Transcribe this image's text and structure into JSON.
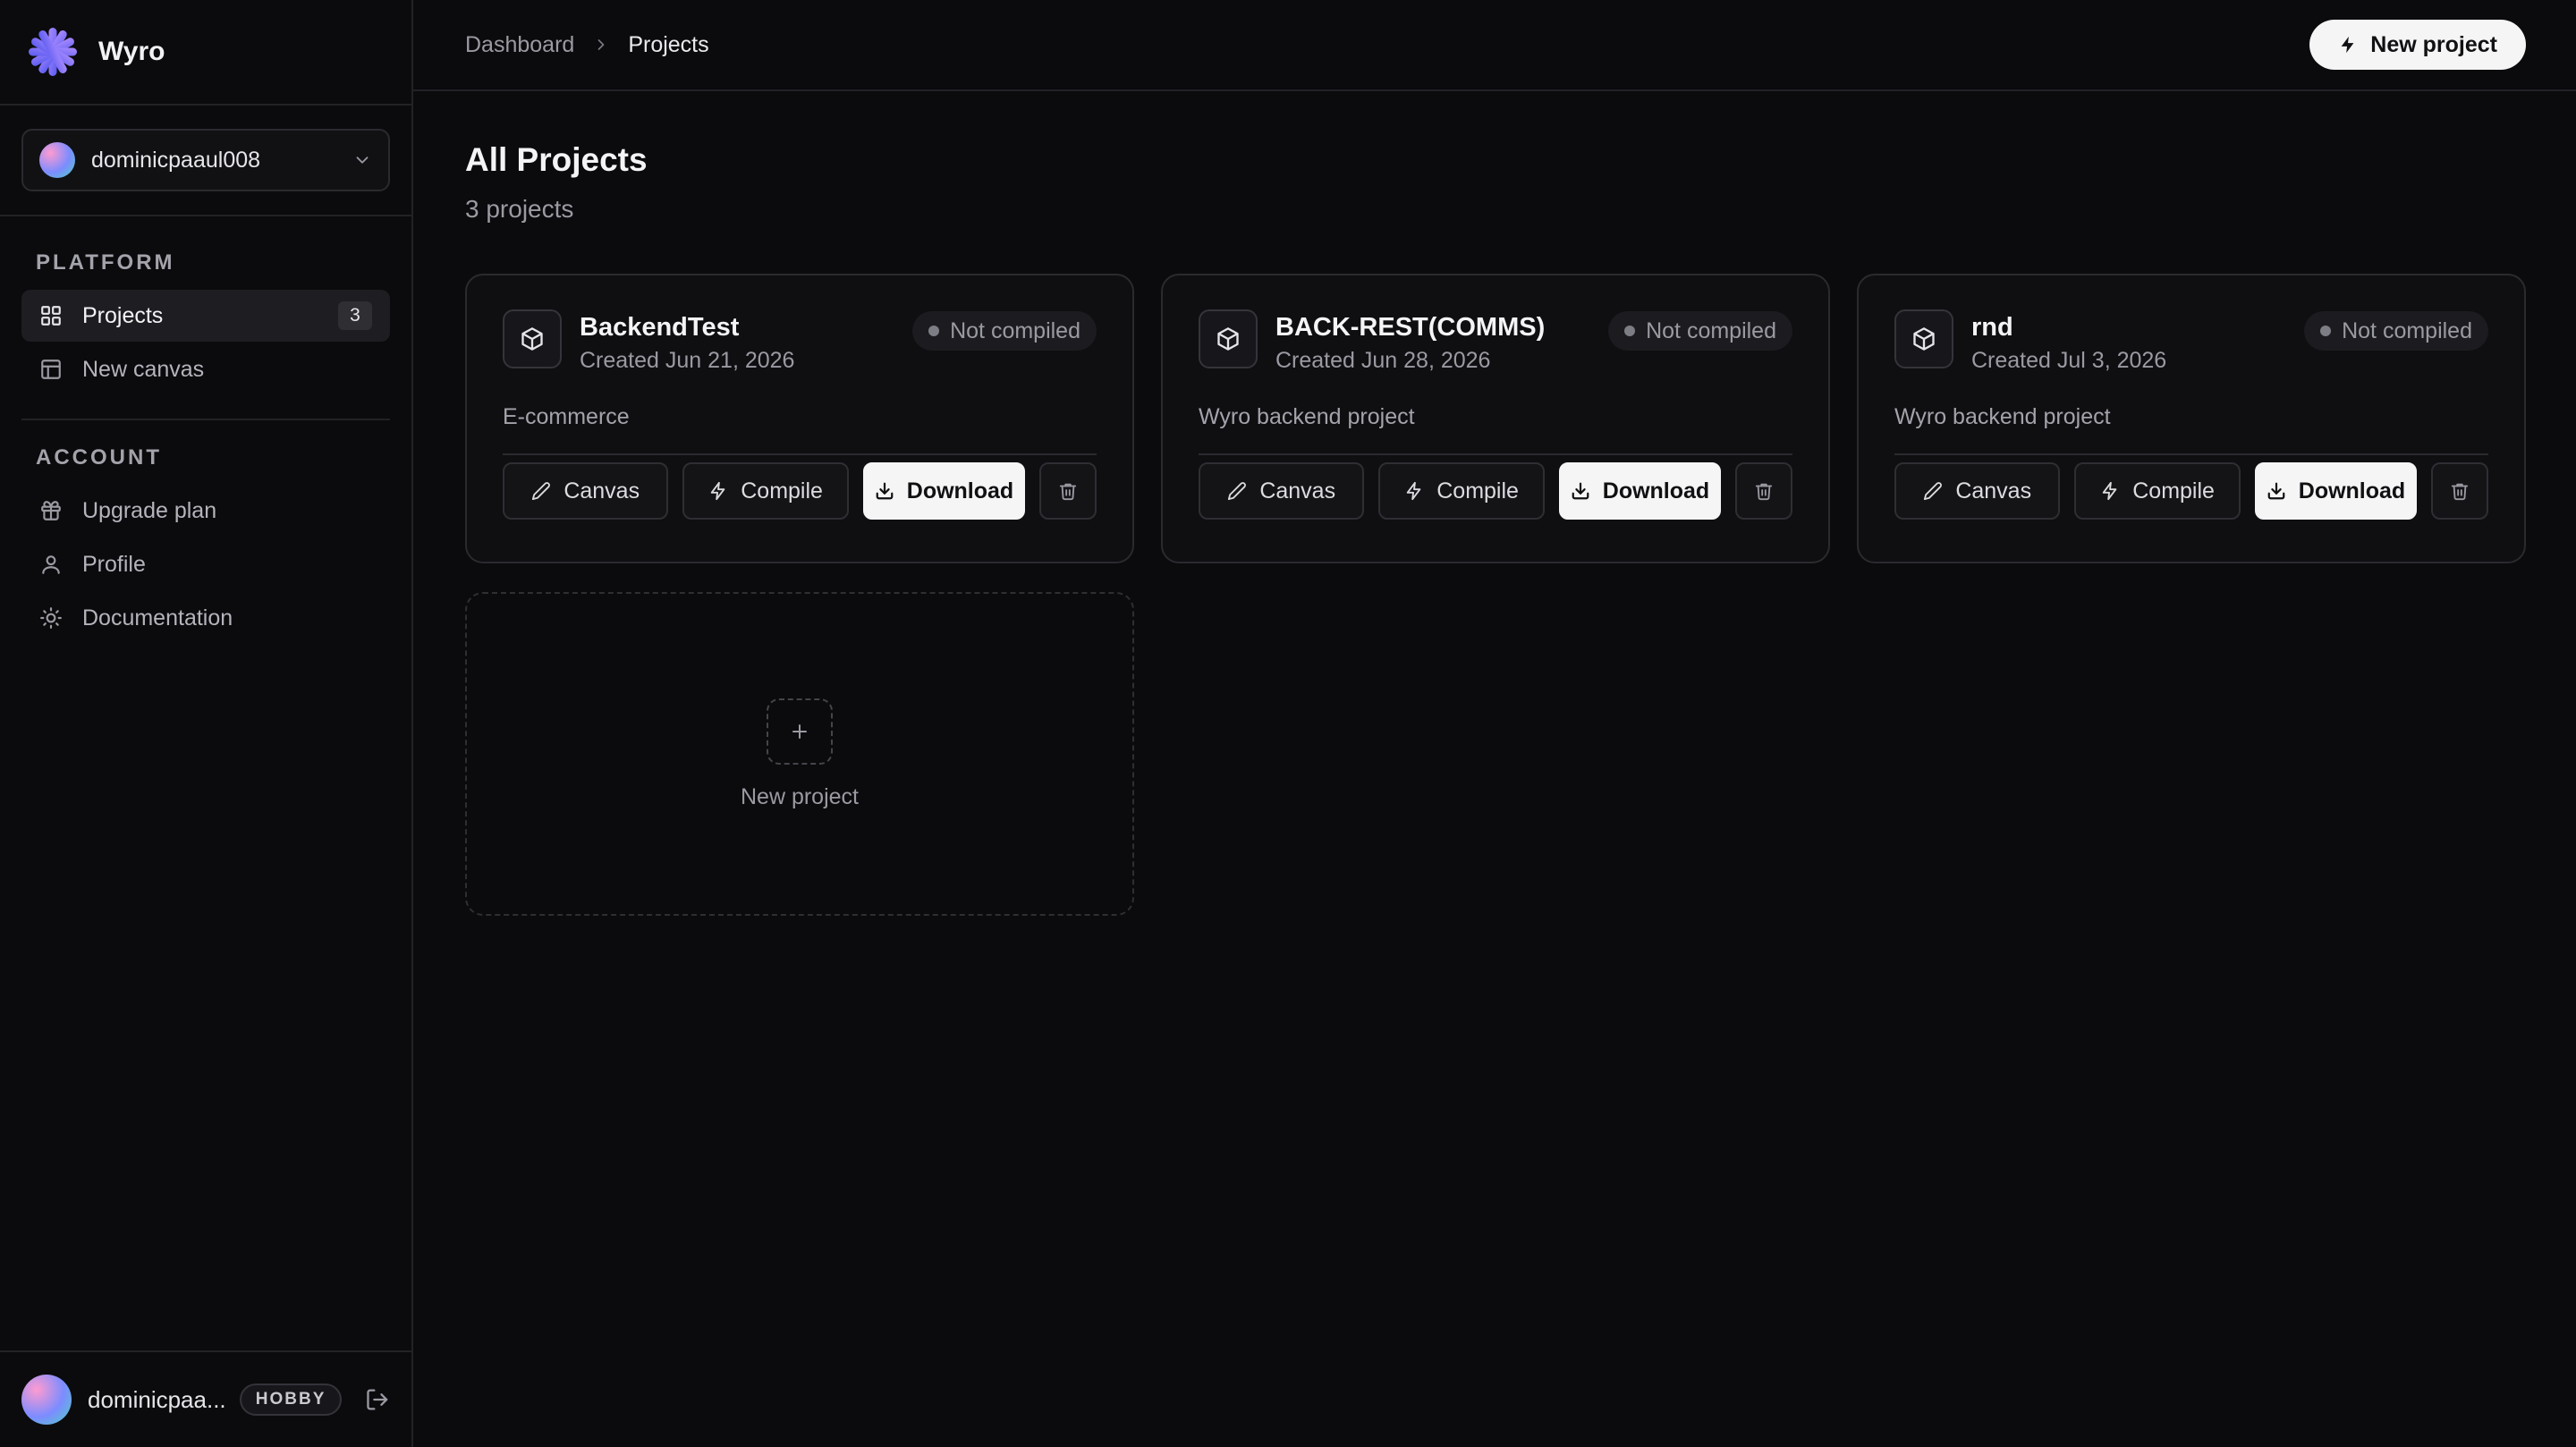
{
  "brand": {
    "name": "Wyro",
    "logo_icon": "asterisk-logo-icon",
    "accent": "#7c6cff"
  },
  "account_switcher": {
    "username": "dominicpaaul008"
  },
  "sidebar": {
    "platform_title": "PLATFORM",
    "platform_items": [
      {
        "label": "Projects",
        "icon": "grid-icon",
        "count": "3",
        "active": true
      },
      {
        "label": "New canvas",
        "icon": "layout-icon"
      }
    ],
    "account_title": "ACCOUNT",
    "account_items": [
      {
        "label": "Upgrade plan",
        "icon": "gift-icon"
      },
      {
        "label": "Profile",
        "icon": "user-icon"
      },
      {
        "label": "Documentation",
        "icon": "sun-icon"
      }
    ]
  },
  "footer": {
    "username": "dominicpaaul008",
    "display_name": "dominicpaa...",
    "plan": "HOBBY"
  },
  "topbar": {
    "breadcrumb": [
      "Dashboard",
      "Projects"
    ],
    "new_project_label": "New project"
  },
  "page": {
    "title": "All Projects",
    "subtitle": "3 projects"
  },
  "card_labels": {
    "canvas": "Canvas",
    "compile": "Compile",
    "download": "Download"
  },
  "projects": [
    {
      "name": "BackendTest",
      "created": "Created Jun 21, 2026",
      "status": "Not compiled",
      "description": "E-commerce"
    },
    {
      "name": "BACK-REST(COMMS)",
      "created": "Created Jun 28, 2026",
      "status": "Not compiled",
      "description": "Wyro backend project"
    },
    {
      "name": "rnd",
      "created": "Created Jul 3, 2026",
      "status": "Not compiled",
      "description": "Wyro backend project"
    }
  ],
  "new_project_card": {
    "label": "New project"
  }
}
